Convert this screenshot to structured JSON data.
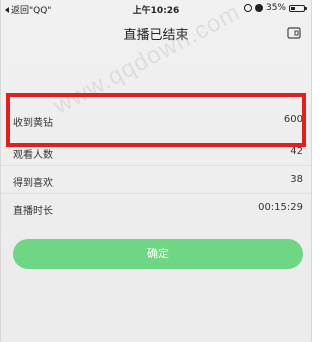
{
  "status_bar": {
    "back_label": "返回\"QQ\"",
    "time": "上午10:26",
    "battery": "35%",
    "battery_level": 0.35,
    "icons": [
      "rotation-lock-icon",
      "alarm-icon",
      "battery-icon"
    ]
  },
  "nav": {
    "title": "直播已结束",
    "exit_icon": "exit-icon"
  },
  "stats": [
    {
      "label": "收到黄钻",
      "value": "600"
    },
    {
      "label": "观看人数",
      "value": "42"
    },
    {
      "label": "得到喜欢",
      "value": "38"
    },
    {
      "label": "直播时长",
      "value": "00:15:29"
    }
  ],
  "confirm_button": {
    "label": "确定",
    "color": "#6fd683"
  },
  "watermark": "www.qqdown.com",
  "colors": {
    "highlight": "#e02020",
    "background": "#efefef",
    "accent": "#6fd683"
  }
}
